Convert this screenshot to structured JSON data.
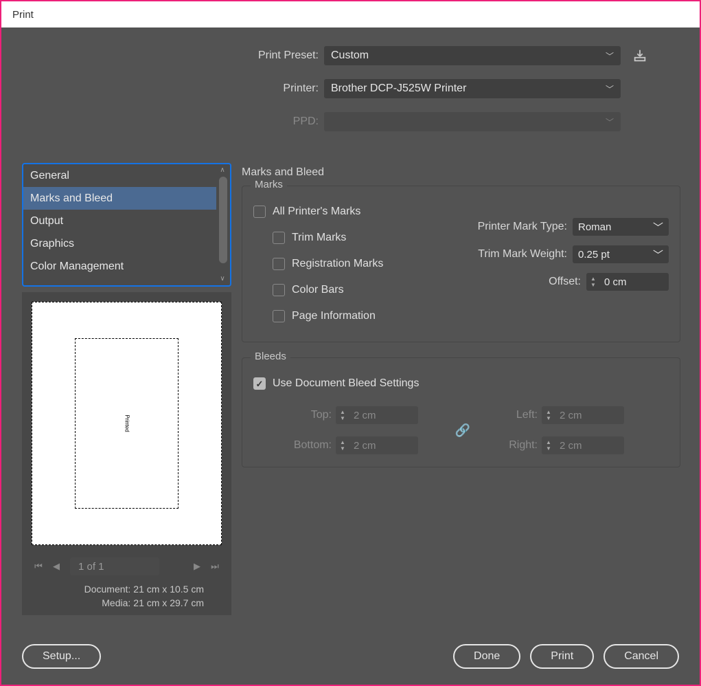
{
  "title": "Print",
  "preset": {
    "print_preset_label": "Print Preset:",
    "print_preset_value": "Custom",
    "printer_label": "Printer:",
    "printer_value": "Brother DCP-J525W Printer",
    "ppd_label": "PPD:",
    "ppd_value": ""
  },
  "categories": {
    "items": [
      {
        "label": "General"
      },
      {
        "label": "Marks and Bleed"
      },
      {
        "label": "Output"
      },
      {
        "label": "Graphics"
      },
      {
        "label": "Color Management"
      }
    ],
    "selected_index": 1
  },
  "preview": {
    "pager_text": "1 of 1",
    "doc_label": "Document:",
    "doc_value": "21 cm x 10.5 cm",
    "media_label": "Media:",
    "media_value": "21 cm x 29.7 cm",
    "caption": "Printed"
  },
  "pane": {
    "title": "Marks and Bleed",
    "marks": {
      "legend": "Marks",
      "all_label": "All Printer's Marks",
      "trim_label": "Trim Marks",
      "reg_label": "Registration Marks",
      "color_bars_label": "Color Bars",
      "page_info_label": "Page Information",
      "mark_type_label": "Printer Mark Type:",
      "mark_type_value": "Roman",
      "trim_weight_label": "Trim Mark Weight:",
      "trim_weight_value": "0.25 pt",
      "offset_label": "Offset:",
      "offset_value": "0 cm"
    },
    "bleeds": {
      "legend": "Bleeds",
      "use_doc_label": "Use Document Bleed Settings",
      "top_label": "Top:",
      "top_value": "2 cm",
      "bottom_label": "Bottom:",
      "bottom_value": "2 cm",
      "left_label": "Left:",
      "left_value": "2 cm",
      "right_label": "Right:",
      "right_value": "2 cm"
    }
  },
  "footer": {
    "setup": "Setup...",
    "done": "Done",
    "print": "Print",
    "cancel": "Cancel"
  }
}
